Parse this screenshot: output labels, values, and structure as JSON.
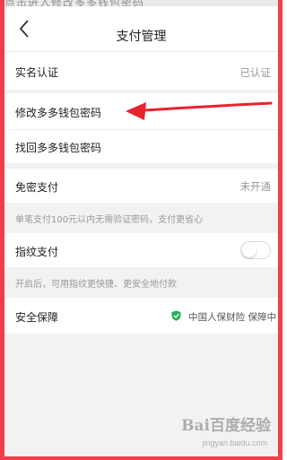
{
  "top_banner": {
    "text": "点击进入修改多多钱包密码"
  },
  "navbar": {
    "title": "支付管理",
    "back_icon": "chevron-left-icon"
  },
  "items": {
    "real_name": {
      "label": "实名认证",
      "value": "已认证"
    },
    "change_password": {
      "label": "修改多多钱包密码"
    },
    "retrieve_password": {
      "label": "找回多多钱包密码"
    },
    "password_free": {
      "label": "免密支付",
      "value": "未开通",
      "hint": "单笔支付100元以内无需验证密码，支付更省心"
    },
    "fingerprint": {
      "label": "指纹支付",
      "enabled": false,
      "hint": "开启后，可用指纹更快捷、更安全地付款"
    },
    "security": {
      "label": "安全保障",
      "value": "中国人保财险 保障中",
      "icon": "shield-check-icon"
    }
  },
  "annotation": {
    "type": "red-arrow",
    "points_to": "修改多多钱包密码"
  },
  "watermark": {
    "brand": "Bai百度经验",
    "url": "jingyan.baidu.com"
  },
  "colors": {
    "frame_border": "#f03e4a",
    "arrow": "#e8232d",
    "shield": "#2ab156"
  }
}
